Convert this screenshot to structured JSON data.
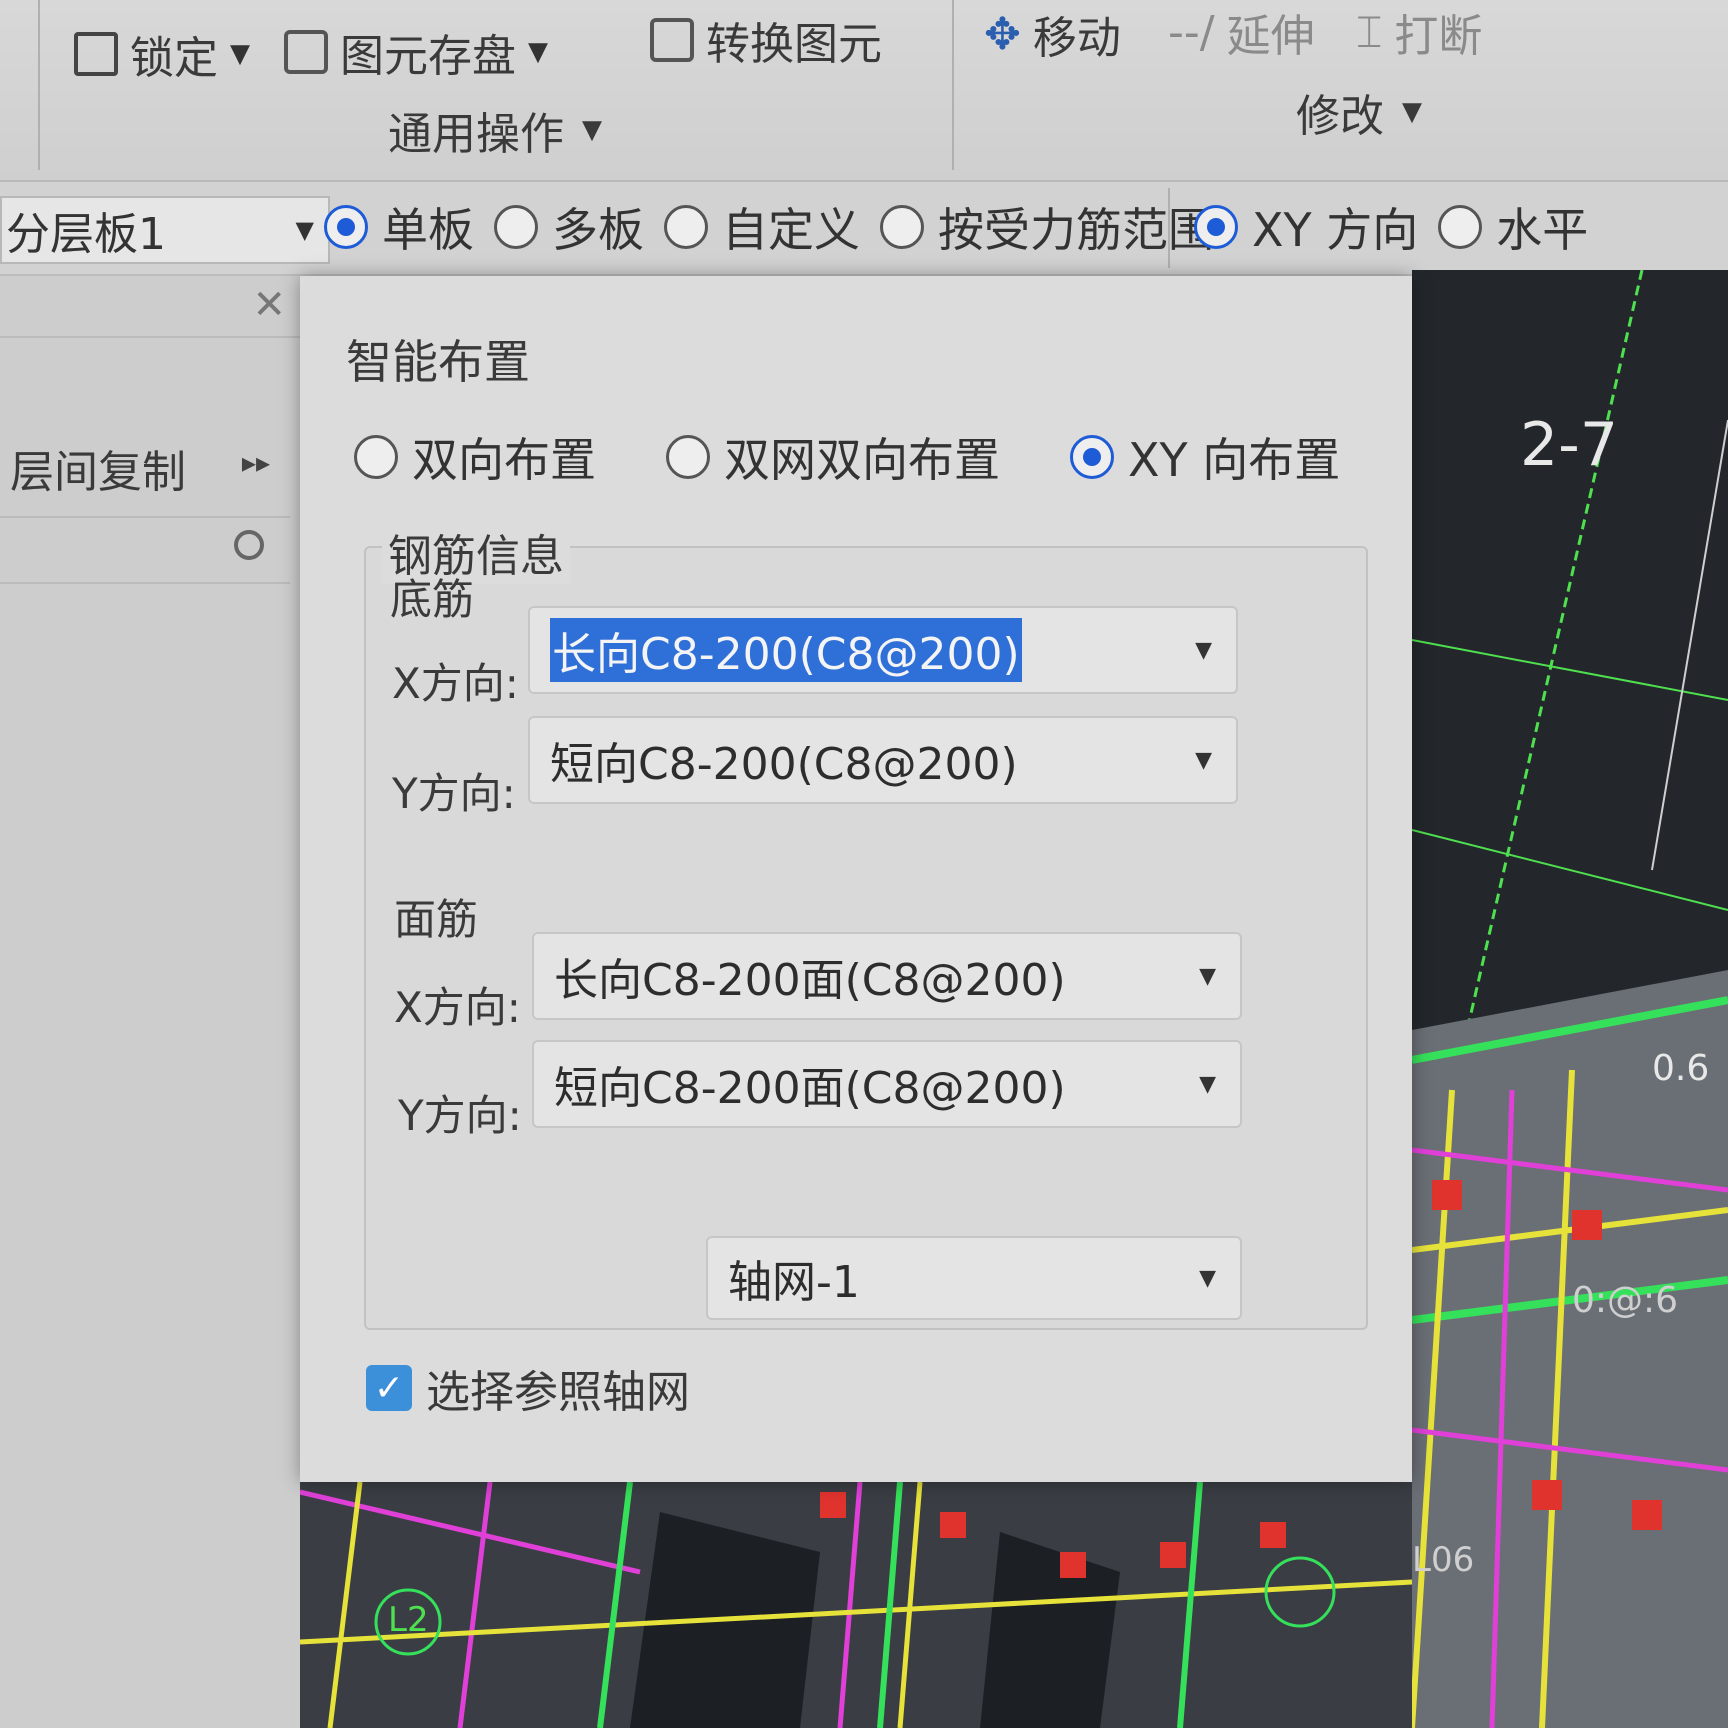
{
  "ribbon": {
    "lock": "锁定",
    "save_elem": "图元存盘",
    "convert_elem": "转换图元",
    "general_ops": "通用操作",
    "move": "移动",
    "extend": "延伸",
    "break": "打断",
    "modify": "修改"
  },
  "optbar": {
    "layer": "分层板1",
    "radios": [
      "单板",
      "多板",
      "自定义",
      "按受力筋范围"
    ],
    "xy_dir": "XY 方向",
    "horizontal": "水平"
  },
  "leftpanel": {
    "copy_between_floors": "层间复制"
  },
  "dialog": {
    "title": "智能布置",
    "modes": [
      "双向布置",
      "双网双向布置",
      "XY 向布置"
    ],
    "rebar_info": "钢筋信息",
    "bottom": {
      "label": "底筋",
      "x_label": "X方向:",
      "x_value": "长向C8-200(C8@200)",
      "y_label": "Y方向:",
      "y_value": "短向C8-200(C8@200)"
    },
    "top": {
      "label": "面筋",
      "x_label": "X方向:",
      "x_value": "长向C8-200面(C8@200)",
      "y_label": "Y方向:",
      "y_value": "短向C8-200面(C8@200)"
    },
    "ref_grid_label": "选择参照轴网",
    "ref_grid_value": "轴网-1"
  },
  "cad": {
    "axis_label": "2-7",
    "dim_a": "0.6",
    "dim_b": "0:@:6",
    "tag_l2": "L2",
    "tag_l06": "L06"
  }
}
